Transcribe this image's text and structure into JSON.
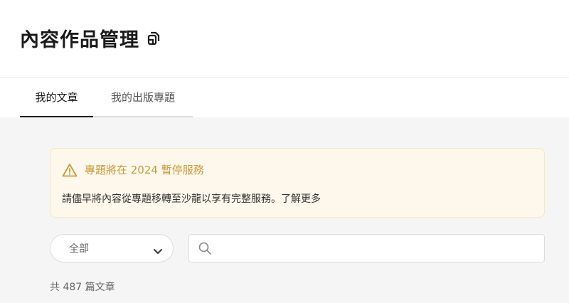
{
  "header": {
    "title": "內容作品管理",
    "title_icon": "copy-icon"
  },
  "tabs": [
    {
      "label": "我的文章",
      "active": true
    },
    {
      "label": "我的出版專題",
      "active": false
    }
  ],
  "notice": {
    "icon": "warning-triangle-icon",
    "title": "專題將在 2024 暫停服務",
    "body": "請儘早將內容從專題移轉至沙龍以享有完整服務。了解更多",
    "accent_color": "#c99a3a",
    "background_color": "#fdf8eb"
  },
  "filter": {
    "selected": "全部",
    "icon": "chevron-down-icon"
  },
  "search": {
    "placeholder": "",
    "value": "",
    "icon": "search-icon"
  },
  "summary": {
    "count_text": "共 487 篇文章"
  }
}
